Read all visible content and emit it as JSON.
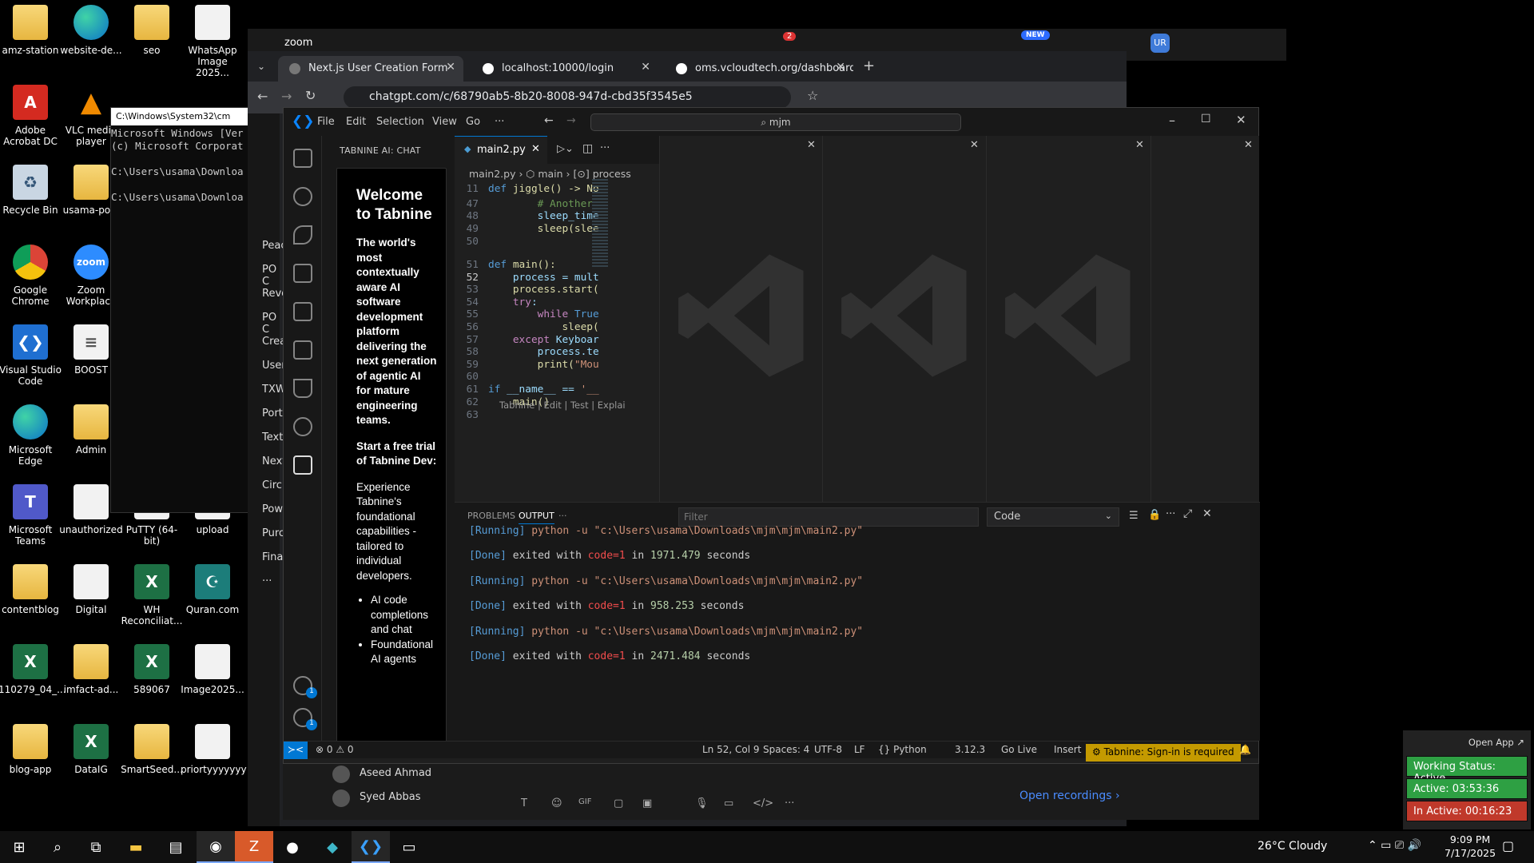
{
  "desktop": {
    "icons": [
      {
        "label": "amz-station",
        "icon": "folder-icon",
        "glyph": ""
      },
      {
        "label": "website-de...",
        "icon": "edge-icon",
        "glyph": ""
      },
      {
        "label": "seo",
        "icon": "folder-icon",
        "glyph": ""
      },
      {
        "label": "WhatsApp Image 2025...",
        "icon": "image-file-icon",
        "glyph": ""
      },
      {
        "label": "Adobe Acrobat DC",
        "icon": "acrobat-icon",
        "glyph": "A"
      },
      {
        "label": "VLC media player",
        "icon": "vlc-icon",
        "glyph": "▲"
      },
      {
        "label": "Recycle Bin",
        "icon": "recycle-bin-icon",
        "glyph": "♻"
      },
      {
        "label": "usama-po...",
        "icon": "folder-icon",
        "glyph": ""
      },
      {
        "label": "Google Chrome",
        "icon": "chrome-icon",
        "glyph": ""
      },
      {
        "label": "Zoom Workplace",
        "icon": "zoom-icon",
        "glyph": "zoom"
      },
      {
        "label": "Visual Studio Code",
        "icon": "vscode-icon",
        "glyph": "❮❯"
      },
      {
        "label": "BOOST",
        "icon": "file-icon",
        "glyph": "≡"
      },
      {
        "label": "Microsoft Edge",
        "icon": "edge-icon",
        "glyph": ""
      },
      {
        "label": "Admin",
        "icon": "folder-icon",
        "glyph": ""
      },
      {
        "label": "Microsoft Teams",
        "icon": "teams-icon",
        "glyph": "T"
      },
      {
        "label": "unauthorized",
        "icon": "image-file-icon",
        "glyph": ""
      },
      {
        "label": "PuTTY (64-bit)",
        "icon": "putty-icon",
        "glyph": "▣"
      },
      {
        "label": "upload",
        "icon": "file-icon",
        "glyph": ""
      },
      {
        "label": "contentblog",
        "icon": "folder-icon",
        "glyph": ""
      },
      {
        "label": "Digital",
        "icon": "image-file-icon",
        "glyph": ""
      },
      {
        "label": "WH Reconciliat...",
        "icon": "excel-icon",
        "glyph": "X"
      },
      {
        "label": "Quran.com",
        "icon": "quran-icon",
        "glyph": "☪"
      },
      {
        "label": "110279_04_...",
        "icon": "excel-icon",
        "glyph": "X"
      },
      {
        "label": "imfact-ad...",
        "icon": "folder-icon",
        "glyph": ""
      },
      {
        "label": "589067",
        "icon": "excel-icon",
        "glyph": "X"
      },
      {
        "label": "Image2025...",
        "icon": "image-file-icon",
        "glyph": ""
      },
      {
        "label": "blog-app",
        "icon": "folder-icon",
        "glyph": ""
      },
      {
        "label": "DataIG",
        "icon": "excel-icon",
        "glyph": "X"
      },
      {
        "label": "SmartSeed...",
        "icon": "folder-icon",
        "glyph": ""
      },
      {
        "label": "priortyyyyyyy",
        "icon": "image-file-icon",
        "glyph": ""
      }
    ]
  },
  "cmd": {
    "title": "C:\\Windows\\System32\\cm",
    "lines": "Microsoft Windows [Ver\n(c) Microsoft Corporat\n\nC:\\Users\\usama\\Downloa\n\nC:\\Users\\usama\\Downloa"
  },
  "zoom": {
    "title": "zoom",
    "new_badge": "NEW",
    "chat_badge": "2",
    "avatar": "UR",
    "contacts": [
      "Aseed Ahmad",
      "Syed Abbas"
    ],
    "open_recordings": "Open recordings  ›"
  },
  "chrome": {
    "tabs": [
      {
        "title": "Next.js User Creation Form"
      },
      {
        "title": "localhost:10000/login"
      },
      {
        "title": "oms.vcloudtech.org/dashboard"
      }
    ],
    "url": "chatgpt.com/c/68790ab5-8b20-8008-947d-cbd35f3545e5",
    "sidebar_items": [
      "Peac",
      "PO C",
      "Reve",
      "PO C",
      "Crea",
      "User",
      "TXW",
      "Port",
      "Text",
      "Next",
      "Circ",
      "Pow",
      "Purc",
      "Fina",
      "···"
    ]
  },
  "vscode": {
    "menu": [
      "File",
      "Edit",
      "Selection",
      "View",
      "Go",
      "···"
    ],
    "search": "⌕ mjm",
    "sidebar_title": "TABNINE AI: CHAT",
    "tabnine": {
      "welcome": "Welcome to Tabnine",
      "intro": "The world's most contextually aware AI software development platform delivering the next generation of agentic AI for mature engineering teams.",
      "trial": "Start a free trial of Tabnine Dev:",
      "experience": "Experience Tabnine's foundational capabilities - tailored to individual developers.",
      "bullets": [
        "AI code completions and chat",
        "Foundational AI agents"
      ]
    },
    "tab": "main2.py",
    "breadcrumb": "main2.py  ›  ⬡ main  ›  [⊙] process",
    "codelens": "Tabnine | Edit | Test | Explai",
    "code": [
      {
        "n": "11",
        "t": "def jiggle() -> No"
      },
      {
        "n": "47",
        "t": "        # Another"
      },
      {
        "n": "48",
        "t": "        sleep_time"
      },
      {
        "n": "49",
        "t": "        sleep(slee"
      },
      {
        "n": "50",
        "t": ""
      },
      {
        "n": "51",
        "t": "def main():"
      },
      {
        "n": "52",
        "t": "    process = mult"
      },
      {
        "n": "53",
        "t": "    process.start("
      },
      {
        "n": "54",
        "t": "    try:"
      },
      {
        "n": "55",
        "t": "        while True"
      },
      {
        "n": "56",
        "t": "            sleep("
      },
      {
        "n": "57",
        "t": "    except Keyboar"
      },
      {
        "n": "58",
        "t": "        process.te"
      },
      {
        "n": "59",
        "t": "        print(\"Mou"
      },
      {
        "n": "60",
        "t": ""
      },
      {
        "n": "61",
        "t": "if __name__ == '__"
      },
      {
        "n": "62",
        "t": "    main()"
      },
      {
        "n": "63",
        "t": ""
      }
    ],
    "panel": {
      "tabs": [
        "PROBLEMS",
        "OUTPUT",
        "···"
      ],
      "filter_placeholder": "Filter",
      "channel": "Code",
      "output": [
        {
          "tag": "[Running]",
          "text": "python -u \"c:\\Users\\usama\\Downloads\\mjm\\mjm\\main2.py\""
        },
        {
          "tag": "[Done]",
          "text": "exited with",
          "code": "code=1",
          "in": "in",
          "secs": "1971.479",
          "unit": "seconds"
        },
        {
          "tag": "[Running]",
          "text": "python -u \"c:\\Users\\usama\\Downloads\\mjm\\mjm\\main2.py\""
        },
        {
          "tag": "[Done]",
          "text": "exited with",
          "code": "code=1",
          "in": "in",
          "secs": "958.253",
          "unit": "seconds"
        },
        {
          "tag": "[Running]",
          "text": "python -u \"c:\\Users\\usama\\Downloads\\mjm\\mjm\\main2.py\""
        },
        {
          "tag": "[Done]",
          "text": "exited with",
          "code": "code=1",
          "in": "in",
          "secs": "2471.484",
          "unit": "seconds"
        }
      ]
    },
    "status": {
      "problems": "⊗ 0 ⚠ 0",
      "position": "Ln 52, Col 9",
      "spaces": "Spaces: 4",
      "encoding": "UTF-8",
      "eol": "LF",
      "language": "{} Python",
      "version": "3.12.3",
      "golive": "Go Live",
      "insert": "Insert",
      "tabnine": "⚙ Tabnine: Sign-in is required"
    },
    "badges": {
      "accounts": "1",
      "settings": "1"
    }
  },
  "widget": {
    "open_app": "Open App ↗",
    "status": "Working Status: Active",
    "active": "Active: 03:53:36",
    "inactive": "In Active: 00:16:23"
  },
  "taskbar": {
    "weather": "26°C  Cloudy",
    "time": "9:09 PM",
    "date": "7/17/2025"
  },
  "colors": {
    "vscode_accent": "#0078d4",
    "tabnine_status": "#c49a00",
    "active_green": "#2ea043",
    "inactive_red": "#c0392b"
  }
}
